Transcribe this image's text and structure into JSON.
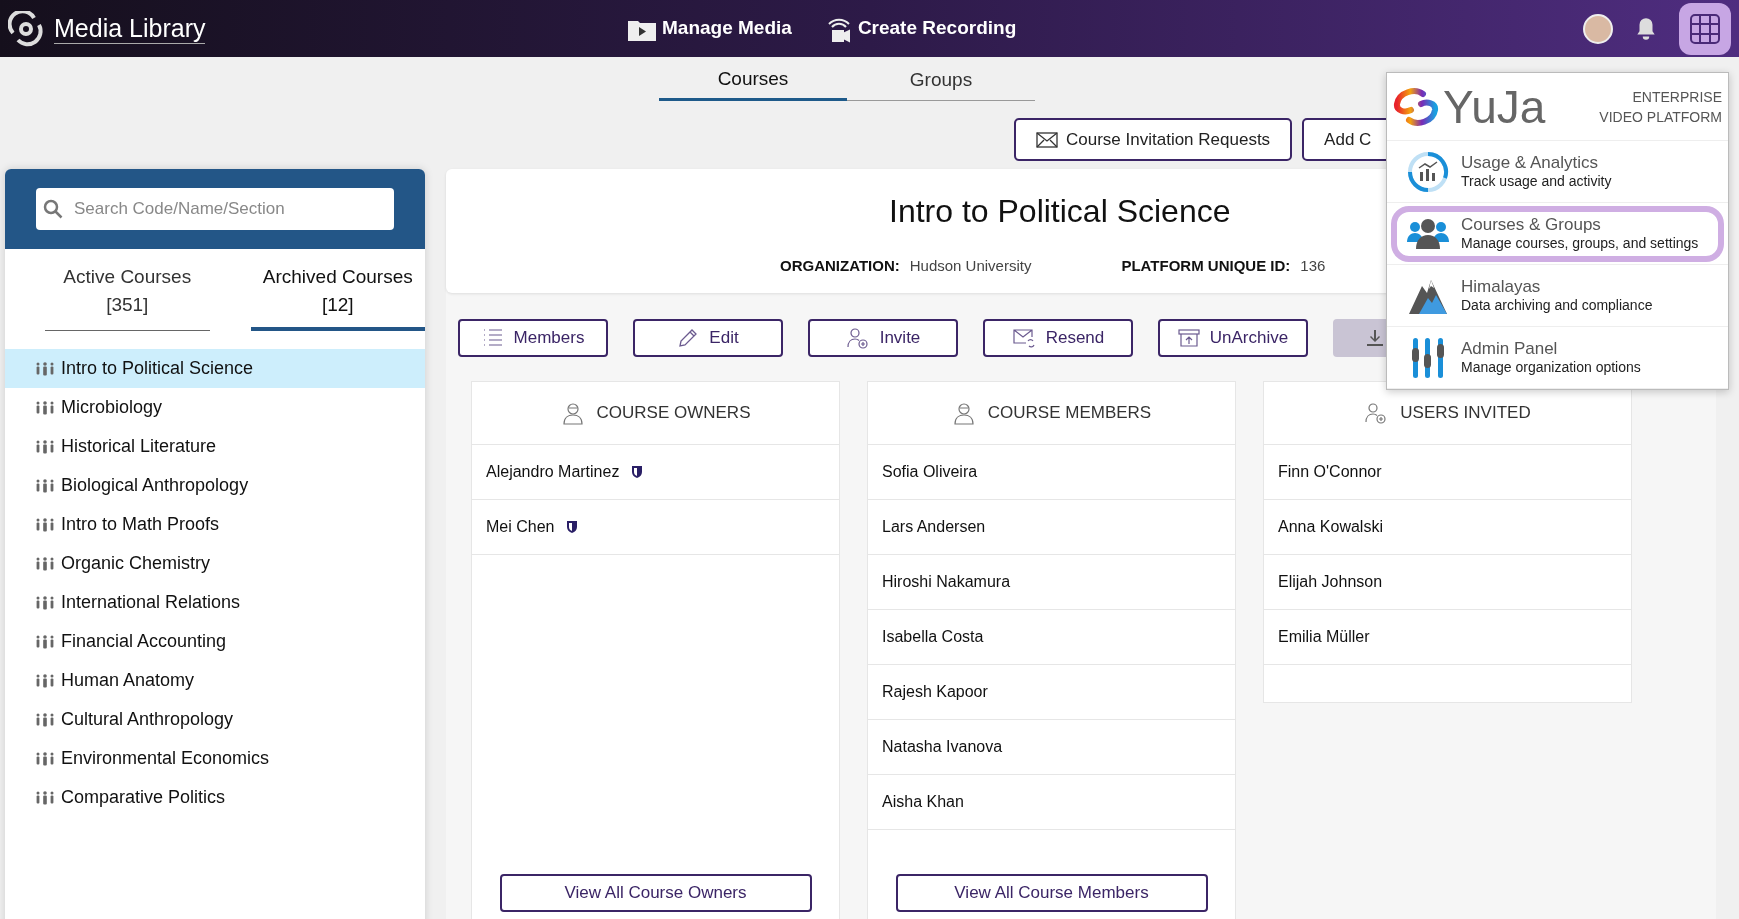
{
  "app_bar": {
    "title": "Media Library",
    "nav": [
      {
        "label": "Manage Media",
        "kind": "media"
      },
      {
        "label": "Create Recording",
        "kind": "record"
      }
    ],
    "apps_open": true
  },
  "top_tabs": [
    {
      "label": "Courses",
      "selected": true
    },
    {
      "label": "Groups",
      "selected": false
    }
  ],
  "top_buttons": [
    {
      "label": "Course Invitation Requests",
      "kind": "mail"
    },
    {
      "label": "Add C",
      "kind": "plain"
    }
  ],
  "sidebar": {
    "search": {
      "placeholder": "Search Code/Name/Section"
    },
    "tabs": [
      {
        "label": "Active Courses",
        "count": "[351]",
        "selected": false
      },
      {
        "label": "Archived Courses",
        "count": "[12]",
        "selected": true
      }
    ],
    "courses": [
      {
        "name": "Intro to Political Science",
        "selected": true
      },
      {
        "name": "Microbiology",
        "selected": false
      },
      {
        "name": "Historical Literature",
        "selected": false
      },
      {
        "name": "Biological Anthropology",
        "selected": false
      },
      {
        "name": "Intro to Math Proofs",
        "selected": false
      },
      {
        "name": "Organic Chemistry",
        "selected": false
      },
      {
        "name": "International Relations",
        "selected": false
      },
      {
        "name": "Financial Accounting",
        "selected": false
      },
      {
        "name": "Human Anatomy",
        "selected": false
      },
      {
        "name": "Cultural Anthropology",
        "selected": false
      },
      {
        "name": "Environmental Economics",
        "selected": false
      },
      {
        "name": "Comparative Politics",
        "selected": false
      }
    ]
  },
  "course": {
    "title": "Intro to Political Science",
    "organization_label": "ORGANIZATION:",
    "organization": "Hudson University",
    "id_label": "PLATFORM UNIQUE ID:",
    "id": "136"
  },
  "actions": [
    {
      "label": "Members",
      "kind": "list",
      "disabled": false
    },
    {
      "label": "Edit",
      "kind": "edit",
      "disabled": false
    },
    {
      "label": "Invite",
      "kind": "invite",
      "disabled": false
    },
    {
      "label": "Resend",
      "kind": "resend",
      "disabled": false
    },
    {
      "label": "UnArchive",
      "kind": "archive",
      "disabled": false
    },
    {
      "kind": "download",
      "disabled": true
    }
  ],
  "columns": [
    {
      "title": "COURSE OWNERS",
      "kind": "person",
      "people": [
        {
          "name": "Alejandro Martinez",
          "badge": true
        },
        {
          "name": "Mei Chen",
          "badge": true
        }
      ],
      "button": "View All Course Owners"
    },
    {
      "title": "COURSE MEMBERS",
      "kind": "person",
      "people": [
        {
          "name": "Sofia Oliveira",
          "badge": false
        },
        {
          "name": "Lars Andersen",
          "badge": false
        },
        {
          "name": "Hiroshi Nakamura",
          "badge": false
        },
        {
          "name": "Isabella Costa",
          "badge": false
        },
        {
          "name": "Rajesh Kapoor",
          "badge": false
        },
        {
          "name": "Natasha Ivanova",
          "badge": false
        },
        {
          "name": "Aisha Khan",
          "badge": false
        }
      ],
      "button": "View All Course Members"
    },
    {
      "title": "USERS INVITED",
      "kind": "invite",
      "people": [
        {
          "name": "Finn O'Connor",
          "badge": false
        },
        {
          "name": "Anna Kowalski",
          "badge": false
        },
        {
          "name": "Elijah Johnson",
          "badge": false
        },
        {
          "name": "Emilia Müller",
          "badge": false
        }
      ]
    }
  ],
  "apps_menu": {
    "brand": "YuJa",
    "tagline": "ENTERPRISE VIDEO PLATFORM",
    "items": [
      {
        "title": "Usage & Analytics",
        "subtitle": "Track usage and activity",
        "kind": "analytics",
        "selected": false
      },
      {
        "title": "Courses & Groups",
        "subtitle": "Manage courses, groups, and settings",
        "kind": "groups",
        "selected": true
      },
      {
        "title": "Himalayas",
        "subtitle": "Data archiving and compliance",
        "kind": "mountain",
        "selected": false
      },
      {
        "title": "Admin Panel",
        "subtitle": "Manage organization options",
        "kind": "admin",
        "selected": false
      }
    ]
  }
}
